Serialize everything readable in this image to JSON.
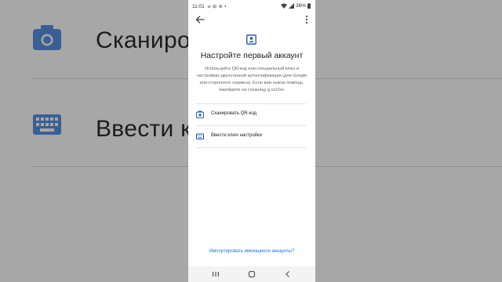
{
  "background": {
    "rows": [
      {
        "icon": "camera-icon",
        "label": "Сканирова"
      },
      {
        "icon": "keyboard-icon",
        "label": "Ввести клю"
      }
    ]
  },
  "status_bar": {
    "time": "11:01",
    "notifications": "ᵾ ⊞ ⊕ •",
    "battery": "36%"
  },
  "app_bar": {
    "back_icon": "arrow-back-icon",
    "menu_icon": "more-vert-icon"
  },
  "setup": {
    "header_icon": "account-box-icon",
    "title": "Настройте первый аккаунт",
    "description": "Используйте QR-код или специальный ключ в настройках двухэтапной аутентификации (для Google или стороннего сервиса). Если вам нужна помощь, перейдите на страницу g.co/2sv.",
    "options": [
      {
        "icon": "camera-icon",
        "label": "Сканировать QR-код"
      },
      {
        "icon": "keyboard-icon",
        "label": "Ввести ключ настройки"
      }
    ],
    "import_link": "Импортировать имеющиеся аккаунты?"
  },
  "nav_bar": {
    "recents_icon": "recents-icon",
    "home_icon": "home-icon",
    "back_icon": "nav-back-icon"
  },
  "colors": {
    "accent": "#1a73e8",
    "icon": "#1a56a8",
    "background": "#a7a7a7"
  }
}
